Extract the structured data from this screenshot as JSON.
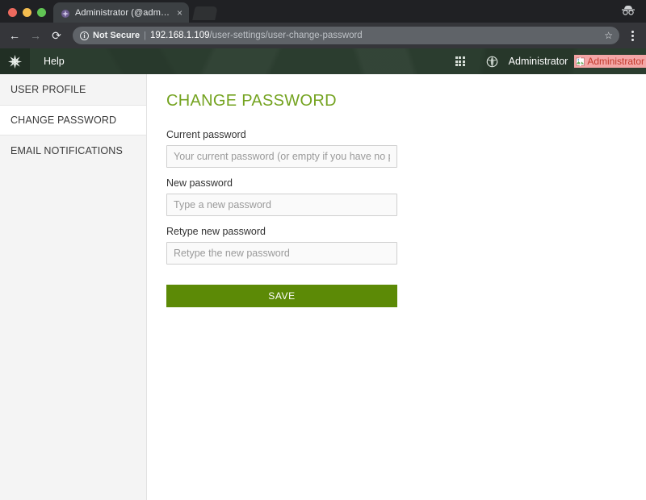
{
  "browser": {
    "tab": {
      "title": "Administrator (@admin)",
      "favicon_name": "site-favicon",
      "close_label": "×"
    },
    "newtab_label": "",
    "incognito_label": "incognito-indicator",
    "nav": {
      "back_label": "←",
      "forward_label": "→",
      "reload_label": "⟳"
    },
    "omnibox": {
      "security_icon_label": "ⓘ",
      "security_text": "Not Secure",
      "separator": "|",
      "url_host": "192.168.1.109",
      "url_path": "/user-settings/user-change-password",
      "star_label": "☆"
    },
    "menu_label": "browser-menu"
  },
  "header": {
    "logo_name": "app-logo-icon",
    "logo_glyph": "✻",
    "help_label": "Help",
    "apps_grid_label": "apps-grid-icon",
    "globe_label": "ἱ0",
    "username": "Administrator",
    "avatar_alt": "Administrator",
    "accent_dark": "#2b3d2f"
  },
  "sidebar": {
    "items": [
      {
        "label": "USER PROFILE",
        "active": false
      },
      {
        "label": "CHANGE PASSWORD",
        "active": true
      },
      {
        "label": "EMAIL NOTIFICATIONS",
        "active": false
      }
    ]
  },
  "main": {
    "title": "CHANGE PASSWORD",
    "title_color": "#74a320",
    "fields": [
      {
        "label": "Current password",
        "placeholder": "Your current password (or empty if you have no password)",
        "value": ""
      },
      {
        "label": "New password",
        "placeholder": "Type a new password",
        "value": ""
      },
      {
        "label": "Retype new password",
        "placeholder": "Retype the new password",
        "value": ""
      }
    ],
    "save_label": "SAVE",
    "save_color": "#5c8a06"
  }
}
